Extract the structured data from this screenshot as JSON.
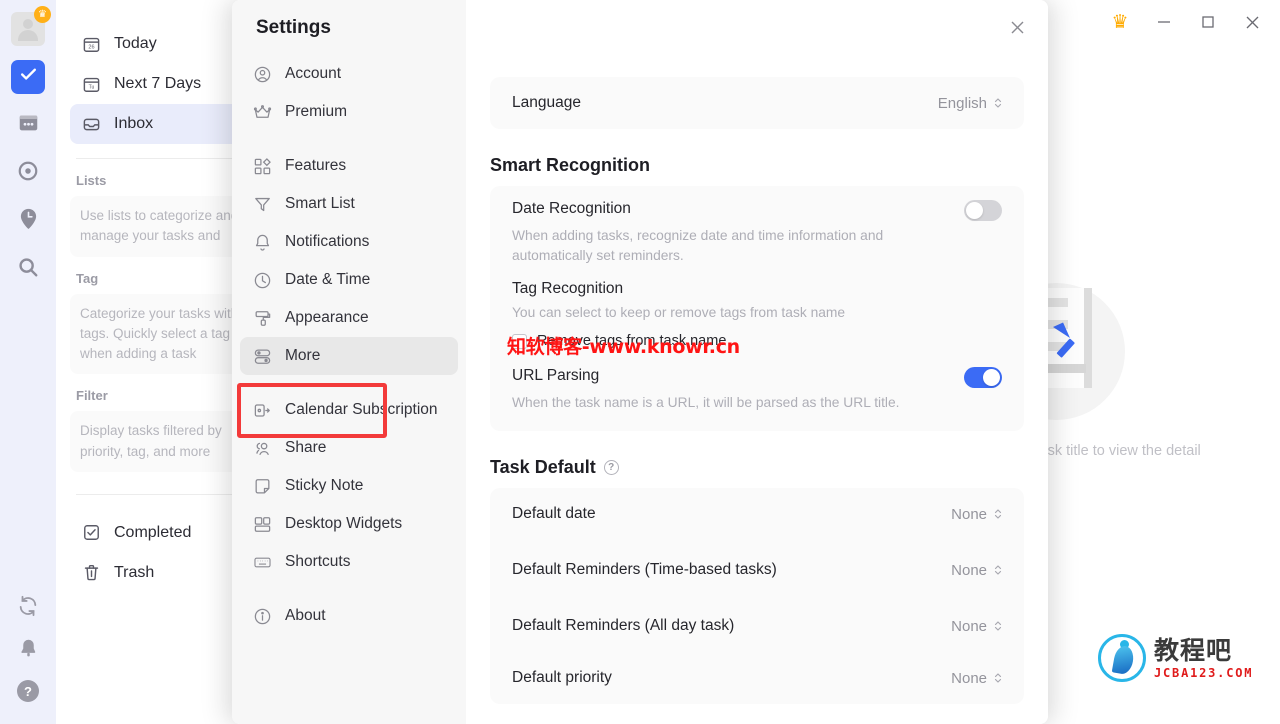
{
  "app": {
    "rail": {
      "avatar_badge_icon": "crown-icon",
      "items": [
        {
          "name": "tasks",
          "icon": "check-icon",
          "active": true
        },
        {
          "name": "calendar",
          "icon": "calendar-icon",
          "active": false
        },
        {
          "name": "focus",
          "icon": "target-icon",
          "active": false
        },
        {
          "name": "pomodoro",
          "icon": "clock-pin-icon",
          "active": false
        },
        {
          "name": "search",
          "icon": "search-icon",
          "active": false
        }
      ],
      "bottom": [
        {
          "name": "sync",
          "icon": "sync-icon"
        },
        {
          "name": "notifications",
          "icon": "bell-icon"
        },
        {
          "name": "help",
          "icon": "help-icon"
        }
      ]
    },
    "nav": {
      "today": "Today",
      "next7": "Next 7 Days",
      "inbox": "Inbox",
      "lists_label": "Lists",
      "lists_hint": "Use lists to categorize and manage your tasks and",
      "tag_label": "Tag",
      "tag_hint": "Categorize your tasks with tags. Quickly select a tag by when adding a task",
      "filter_label": "Filter",
      "filter_hint": "Display tasks filtered by priority, tag, and more",
      "completed": "Completed",
      "trash": "Trash"
    },
    "detail_empty_text": "Click a task title to view the detail",
    "window_controls": {
      "premium": "premium-crown",
      "minimize": "–",
      "maximize": "□",
      "close": "✕"
    }
  },
  "settings": {
    "title": "Settings",
    "nav_groups": [
      [
        {
          "label": "Account",
          "icon": "user-circle-icon",
          "active": false
        },
        {
          "label": "Premium",
          "icon": "crown-icon",
          "active": false
        }
      ],
      [
        {
          "label": "Features",
          "icon": "grid-icon",
          "active": false
        },
        {
          "label": "Smart List",
          "icon": "funnel-icon",
          "active": false
        },
        {
          "label": "Notifications",
          "icon": "bell-icon",
          "active": false
        },
        {
          "label": "Date & Time",
          "icon": "clock-icon",
          "active": false
        },
        {
          "label": "Appearance",
          "icon": "paint-roller-icon",
          "active": false
        },
        {
          "label": "More",
          "icon": "sliders-icon",
          "active": true
        }
      ],
      [
        {
          "label": "Calendar Subscription",
          "icon": "calendar-arrow-icon",
          "active": false
        },
        {
          "label": "Share",
          "icon": "people-icon",
          "active": false
        },
        {
          "label": "Sticky Note",
          "icon": "note-icon",
          "active": false
        },
        {
          "label": "Desktop Widgets",
          "icon": "widgets-icon",
          "active": false
        },
        {
          "label": "Shortcuts",
          "icon": "keyboard-icon",
          "active": false
        }
      ],
      [
        {
          "label": "About",
          "icon": "info-icon",
          "active": false
        }
      ]
    ],
    "close_icon": "✕",
    "language": {
      "label": "Language",
      "value": "English"
    },
    "smart_recognition": {
      "heading": "Smart Recognition",
      "date_recognition": {
        "title": "Date Recognition",
        "desc": "When adding tasks, recognize date and time information and automatically set reminders.",
        "enabled": false
      },
      "tag_recognition": {
        "title": "Tag Recognition",
        "desc": "You can select to keep or remove tags from task name",
        "checkbox_label": "Remove tags from task name",
        "checked": false
      },
      "url_parsing": {
        "title": "URL Parsing",
        "desc": "When the task name is a URL, it will be parsed as the URL title.",
        "enabled": true
      }
    },
    "task_default": {
      "heading": "Task Default",
      "help_icon": "question-icon",
      "rows": [
        {
          "label": "Default date",
          "value": "None"
        },
        {
          "label": "Default Reminders (Time-based tasks)",
          "value": "None"
        },
        {
          "label": "Default Reminders (All day task)",
          "value": "None"
        },
        {
          "label": "Default priority",
          "value": "None"
        }
      ]
    },
    "highlight": {
      "target": "More",
      "color": "#f33a3a"
    }
  },
  "watermarks": {
    "red_text": "知软博客-www.knowr.cn",
    "logo_cn": "教程吧",
    "logo_en": "JCBA123.COM"
  },
  "colors": {
    "accent": "#3b6bf5",
    "rail_bg": "#eef0fb",
    "settings_nav_bg": "#f7f7f7",
    "card_bg": "#fafafa",
    "highlight_red": "#f33a3a",
    "crown_gold": "#ffab00"
  }
}
